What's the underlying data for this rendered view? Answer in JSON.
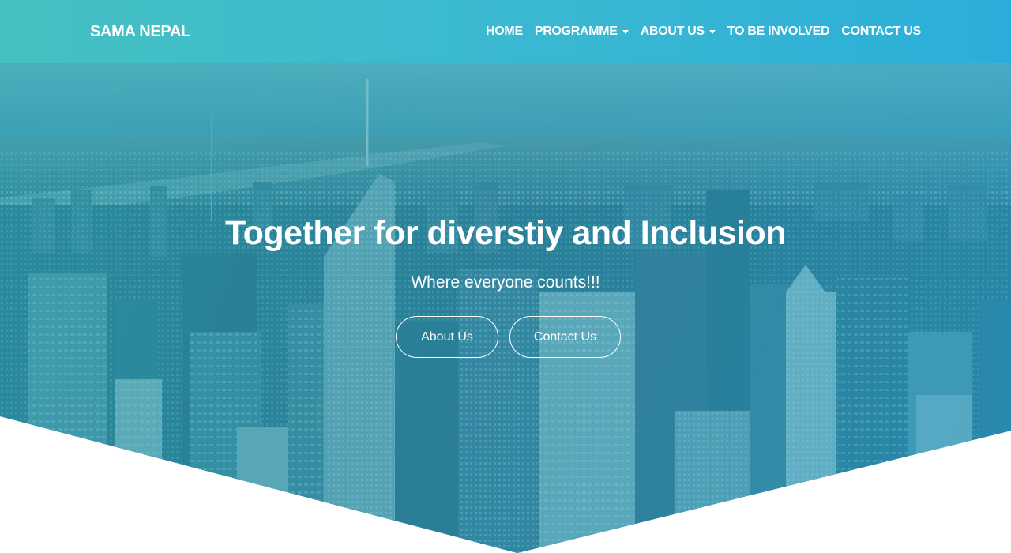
{
  "brand": {
    "name": "SAMA NEPAL"
  },
  "nav": {
    "items": [
      {
        "label": "HOME",
        "dropdown": false
      },
      {
        "label": "PROGRAMME",
        "dropdown": true
      },
      {
        "label": "ABOUT US",
        "dropdown": true
      },
      {
        "label": "TO BE INVOLVED",
        "dropdown": false
      },
      {
        "label": "CONTACT US",
        "dropdown": false
      }
    ]
  },
  "hero": {
    "title": "Together for diverstiy and Inclusion",
    "subtitle": "Where everyone counts!!!",
    "buttons": {
      "about": "About Us",
      "contact": "Contact Us"
    }
  },
  "colors": {
    "navbar_start": "#45c0c1",
    "navbar_end": "#2aaed9",
    "hero_tint": "#257e98",
    "text": "#ffffff"
  }
}
